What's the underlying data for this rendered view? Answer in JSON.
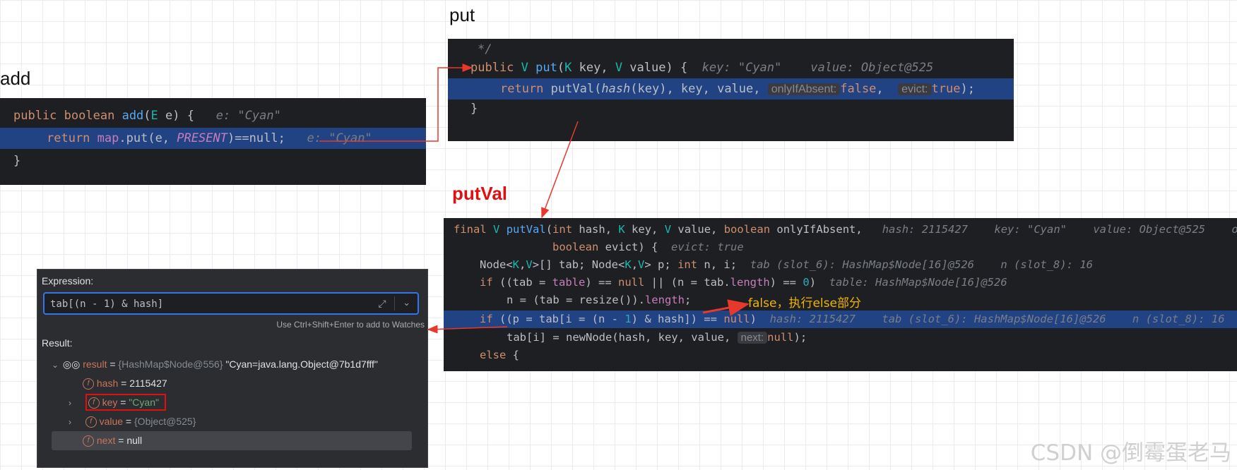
{
  "titles": {
    "add": "add",
    "put": "put",
    "putval": "putVal"
  },
  "add_panel": {
    "l1": {
      "kw1": "public",
      "kw2": "boolean",
      "fn": "add",
      "p1": "(",
      "ty": "E",
      "p2": " e) {",
      "hint": "e: \"Cyan\""
    },
    "l2": {
      "kw": "return",
      "fld": "map",
      "p1": ".put(e, ",
      "cst": "PRESENT",
      "p2": ")==null;",
      "hint": "e: \"Cyan\""
    },
    "l3": "}"
  },
  "put_panel": {
    "l0": "*/",
    "l1": {
      "kw": "public",
      "ty1": "V",
      "fn": "put",
      "p1": "(",
      "ty2": "K",
      "p2": " key, ",
      "ty3": "V",
      "p3": " value) {",
      "hint1": "key: \"Cyan\"",
      "hint2": "value: Object@525"
    },
    "l2": {
      "kw": "return",
      "p1": " putVal(",
      "hfn": "hash",
      "p2": "(key), key, value, ",
      "chip1": "onlyIfAbsent:",
      "v1": "false",
      "p3": ", ",
      "chip2": "evict:",
      "v2": "true",
      "p4": ");"
    },
    "l3": "}"
  },
  "putval_panel": {
    "l1": {
      "kw1": "final",
      "ty1": "V",
      "fn": "putVal",
      "p1": "(",
      "kw2": "int",
      "p2": " hash, ",
      "ty2": "K",
      "p3": " key, ",
      "ty3": "V",
      "p4": " value, ",
      "kw3": "boolean",
      "p5": " onlyIfAbsent,",
      "h1": "hash: 2115427",
      "h2": "key: \"Cyan\"",
      "h3": "value: Object@525",
      "h4": "o"
    },
    "l2": {
      "kw": "boolean",
      "p": " evict) {",
      "hint": "evict: true"
    },
    "l3": {
      "p1": "Node<",
      "k": "K",
      "p2": ",",
      "v": "V",
      "p3": ">[] tab; Node<",
      "k2": "K",
      "p4": ",",
      "v2": "V",
      "p5": "> p; ",
      "kw": "int",
      "p6": " n, i;",
      "h1": "tab (slot_6): HashMap$Node[16]@526",
      "h2": "n (slot_8): 16"
    },
    "l4": {
      "kw": "if",
      "p1": " ((tab = ",
      "f1": "table",
      "p2": ") == ",
      "kw2": "null",
      "p3": " || (n = tab.",
      "f2": "length",
      "p4": ") == ",
      "num": "0",
      "p5": ")",
      "hint": "table: HashMap$Node[16]@526"
    },
    "l5": {
      "p1": "n = (tab = resize()).",
      "f": "length",
      "p2": ";"
    },
    "l6": {
      "kw": "if",
      "p1": " ((p = tab[i = (n - ",
      "num": "1",
      "p2": ") & hash]) == ",
      "kw2": "null",
      "p3": ")",
      "h1": "hash: 2115427",
      "h2": "tab (slot_6): HashMap$Node[16]@526",
      "h3": "n (slot_8): 16"
    },
    "l7": {
      "p1": "tab[i] = newNode(hash, key, value, ",
      "chip": "next:",
      "kw": "null",
      "p2": ");"
    },
    "l8": {
      "kw": "else",
      "p": " {"
    }
  },
  "annotation": "false，执行else部分",
  "eval_panel": {
    "expression_label": "Expression:",
    "expression": "tab[(n - 1) & hash]",
    "hint": "Use Ctrl+Shift+Enter to add to Watches",
    "result_label": "Result:",
    "rows": [
      {
        "name": "result",
        "eq": " = ",
        "type": "{HashMap$Node@556}",
        "val": " \"Cyan=java.lang.Object@7b1d7fff\""
      },
      {
        "name": "hash",
        "eq": " = ",
        "val": "2115427"
      },
      {
        "name": "key",
        "eq": " = ",
        "val": "\"Cyan\""
      },
      {
        "name": "value",
        "eq": " = ",
        "val": "{Object@525}"
      },
      {
        "name": "next",
        "eq": " = ",
        "val": "null"
      }
    ]
  },
  "watermark": "CSDN @倒霉蛋老马",
  "colors": {
    "arrow": "#e8382c",
    "putval_title": "#e01010",
    "annotation": "#f0b400",
    "highlight": "#214283",
    "focus": "#3574f0"
  }
}
